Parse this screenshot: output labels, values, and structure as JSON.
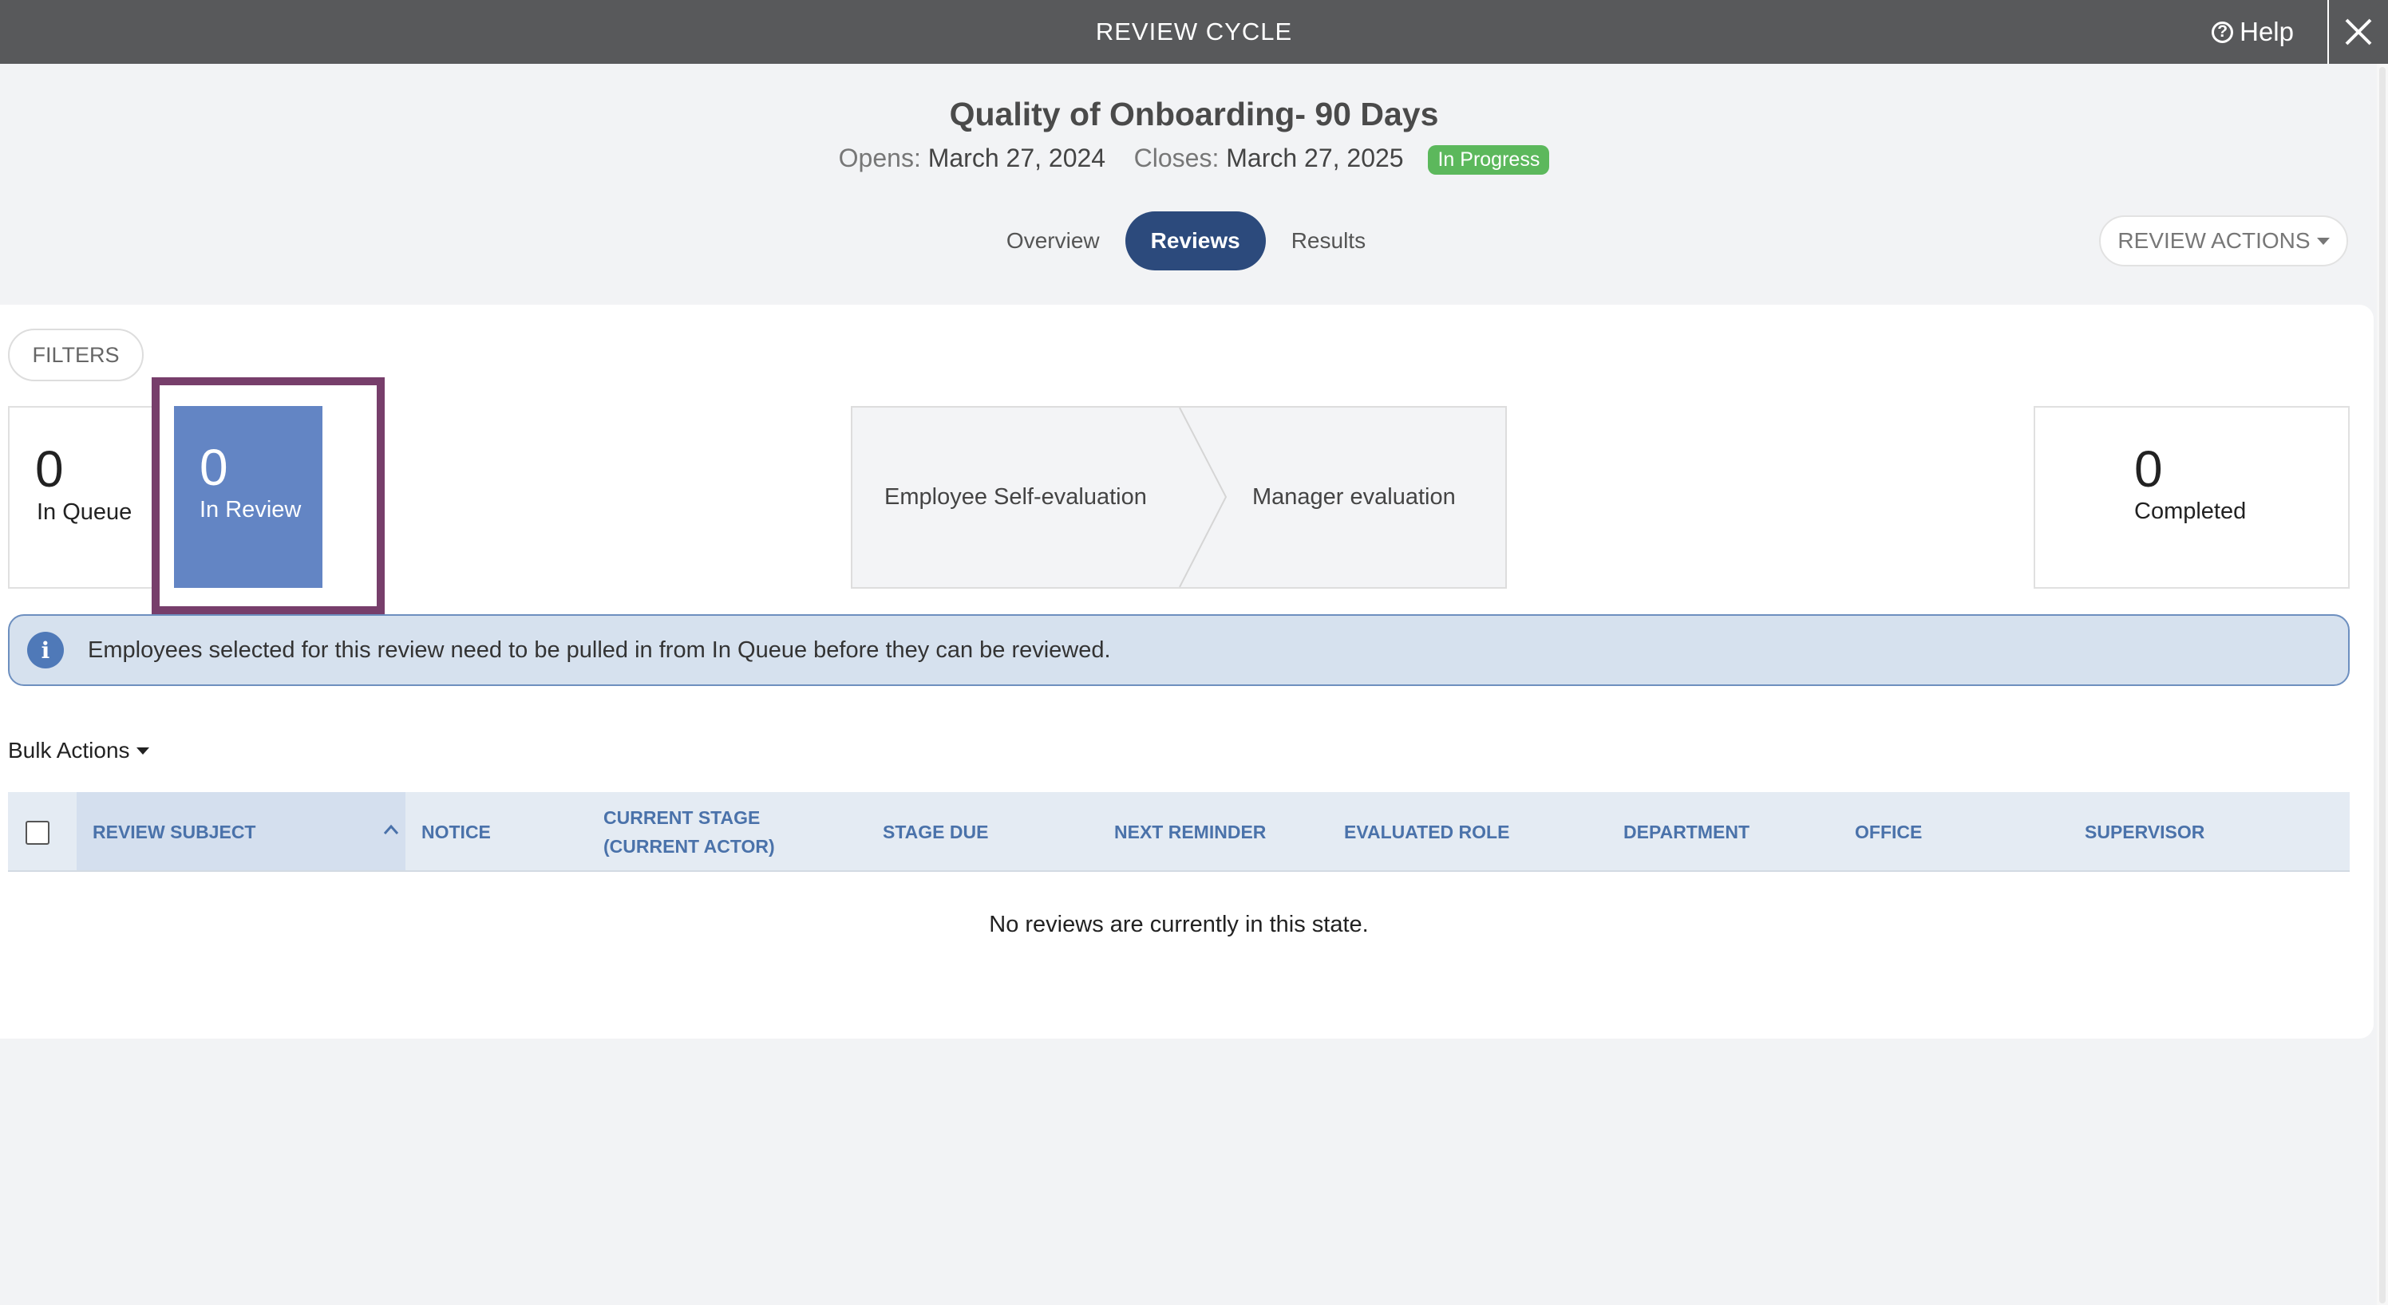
{
  "topbar": {
    "title": "REVIEW CYCLE",
    "help_label": "Help"
  },
  "header": {
    "title": "Quality of Onboarding- 90 Days",
    "opens_label": "Opens:",
    "opens_date": "March 27, 2024",
    "closes_label": "Closes:",
    "closes_date": "March 27, 2025",
    "status": "In Progress"
  },
  "tabs": [
    {
      "label": "Overview",
      "active": false
    },
    {
      "label": "Reviews",
      "active": true
    },
    {
      "label": "Results",
      "active": false
    }
  ],
  "review_actions_label": "REVIEW ACTIONS",
  "filters_label": "FILTERS",
  "stats": {
    "queue": {
      "count": "0",
      "label": "In Queue"
    },
    "in_review": {
      "count": "0",
      "label": "In Review"
    },
    "completed": {
      "count": "0",
      "label": "Completed"
    }
  },
  "stages": [
    "Employee Self-evaluation",
    "Manager evaluation"
  ],
  "info_message": "Employees selected for this review need to be pulled in from In Queue before they can be reviewed.",
  "bulk_actions_label": "Bulk Actions",
  "table": {
    "columns": [
      "REVIEW SUBJECT",
      "NOTICE",
      "CURRENT STAGE",
      "(CURRENT ACTOR)",
      "STAGE DUE",
      "NEXT REMINDER",
      "EVALUATED ROLE",
      "DEPARTMENT",
      "OFFICE",
      "SUPERVISOR"
    ],
    "empty_message": "No reviews are currently in this state."
  },
  "colors": {
    "topbar": "#58595b",
    "accent": "#2c4a7c",
    "in_review": "#6385c4",
    "highlight": "#773e6b",
    "status": "#5cb85c"
  }
}
